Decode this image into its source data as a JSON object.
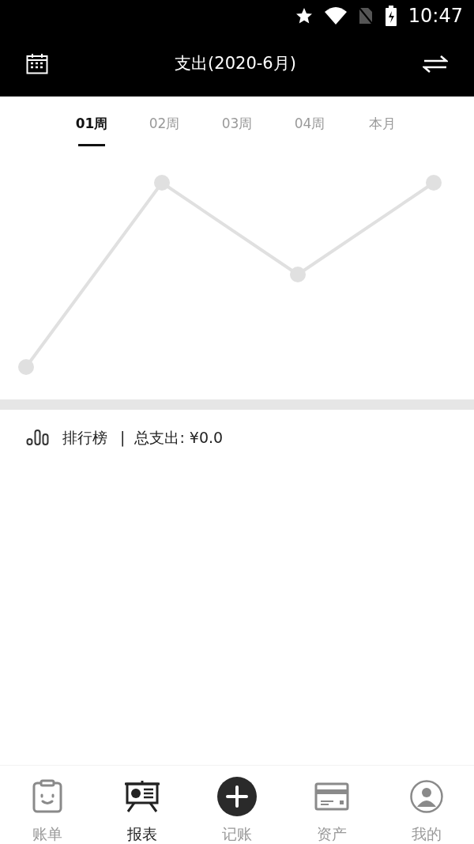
{
  "status_bar": {
    "time": "10:47"
  },
  "header": {
    "title": "支出(2020-6月)"
  },
  "tabs": [
    {
      "label": "01周",
      "selected": true
    },
    {
      "label": "02周",
      "selected": false
    },
    {
      "label": "03周",
      "selected": false
    },
    {
      "label": "04周",
      "selected": false
    },
    {
      "label": "本月",
      "selected": false
    }
  ],
  "ranking": {
    "label": "排行榜",
    "separator": "|",
    "total": "总支出: ¥0.0"
  },
  "bottom_nav": [
    {
      "kind": "bill",
      "label": "账单",
      "selected": false
    },
    {
      "kind": "report",
      "label": "报表",
      "selected": true
    },
    {
      "kind": "add",
      "label": "记账",
      "selected": false
    },
    {
      "kind": "assets",
      "label": "资产",
      "selected": false
    },
    {
      "kind": "profile",
      "label": "我的",
      "selected": false
    }
  ]
}
